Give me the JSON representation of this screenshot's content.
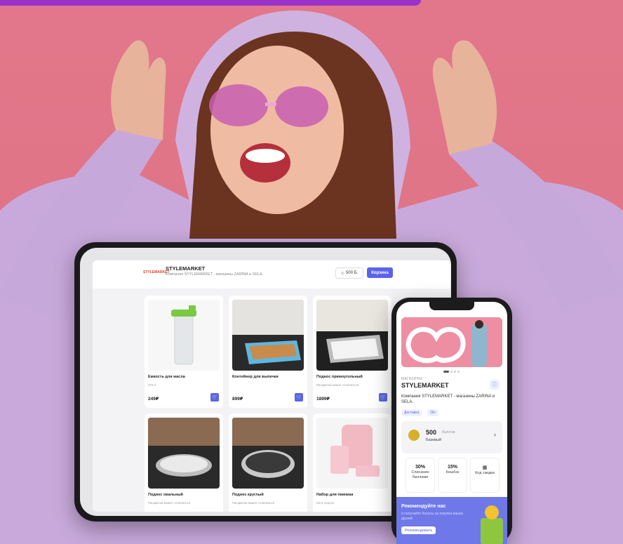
{
  "tablet": {
    "logo_text": "STYLEMARKET",
    "store_title": "STYLEMARKET",
    "store_subtitle": "Компания STYLEMARKET - магазины ZARINA и SELA.",
    "points_label": "500 Б.",
    "cart_button": "Корзина",
    "products": [
      {
        "name": "Емкость для масла",
        "desc": "375 п",
        "price": "249₽"
      },
      {
        "name": "Контейнер для выпечки",
        "desc": "",
        "price": "899₽"
      },
      {
        "name": "Поднос прямоугольный",
        "desc": "Расцветка может отличаться",
        "price": "1899₽"
      },
      {
        "name": "Поднос овальный",
        "desc": "Расцветка может отличаться",
        "price": ""
      },
      {
        "name": "Поднос круглый",
        "desc": "Расцветка может отличаться",
        "price": ""
      },
      {
        "name": "Набор для пикника",
        "desc": "На 6 персон",
        "price": ""
      }
    ]
  },
  "phone": {
    "category": "Магазины",
    "store_title": "STYLEMARKET",
    "description": "Компания STYLEMARKET - магазины ZARINA и SELA.",
    "tags": [
      "Доставка",
      "18+"
    ],
    "points_value": "500",
    "points_unit": "баллов",
    "level": "Базовый",
    "stats": [
      {
        "value": "30%",
        "label": "Списание баллами"
      },
      {
        "value": "15%",
        "label": "Кешбэк"
      },
      {
        "value": "",
        "label": "Код скидки"
      }
    ],
    "referral_title": "Рекомендуйте нас",
    "referral_subtitle": "и получайте бонусы за покупки ваших друзей",
    "referral_button": "Рекомендовать"
  },
  "colors": {
    "background": "#e2768a",
    "accent": "#5b63ea",
    "top_bar": "#9a32c9"
  }
}
